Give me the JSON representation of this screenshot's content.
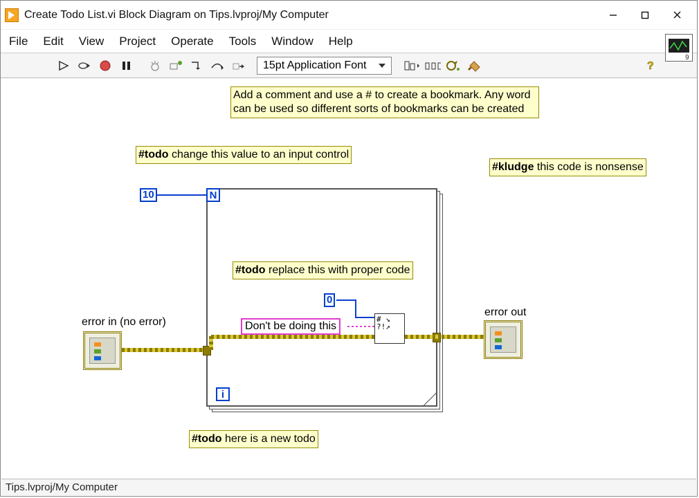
{
  "window": {
    "title": "Create Todo List.vi Block Diagram on Tips.lvproj/My Computer"
  },
  "menus": [
    "File",
    "Edit",
    "View",
    "Project",
    "Operate",
    "Tools",
    "Window",
    "Help"
  ],
  "toolbar": {
    "font": "15pt Application Font"
  },
  "status": {
    "path": "Tips.lvproj/My Computer"
  },
  "diagram": {
    "big_comment": "Add a comment and use a # to create a bookmark.  Any word can be used so different sorts of bookmarks can be created",
    "todo_input": {
      "tag": "#todo",
      "text": " change this value to an input control"
    },
    "kludge": {
      "tag": "#kludge",
      "text": " this code is nonsense"
    },
    "todo_replace": {
      "tag": "#todo",
      "text": " replace this with proper code"
    },
    "todo_new": {
      "tag": "#todo",
      "text": " here is a new todo"
    },
    "const10": "10",
    "const0": "0",
    "loopN": "N",
    "loopI": "i",
    "pink_text": "Don't be doing this",
    "err_in_label": "error in (no error)",
    "err_out_label": "error out",
    "subvi_glyphs": "# ↘\n?!↗"
  }
}
